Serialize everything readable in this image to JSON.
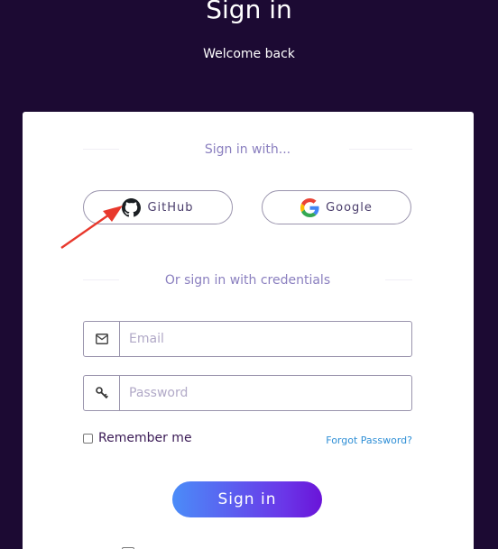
{
  "hero": {
    "title": "Sign in",
    "subtitle": "Welcome back"
  },
  "social": {
    "heading": "Sign in with...",
    "github_label": "GitHub",
    "google_label": "Google"
  },
  "credentials": {
    "heading": "Or sign in with credentials",
    "email_placeholder": "Email",
    "password_placeholder": "Password",
    "remember_label": "Remember me",
    "forgot_label": "Forgot Password?",
    "submit_label": "Sign in"
  },
  "icons": {
    "github": "github-icon",
    "google": "google-icon",
    "email": "envelope-icon",
    "password": "key-icon"
  },
  "colors": {
    "page_background": "#1c0a33",
    "accent_text": "#8a7fbf",
    "link": "#2f8fd6",
    "button_gradient_start": "#4b8cf8",
    "button_gradient_end": "#6a14d8",
    "annotation_arrow": "#e8382c"
  }
}
